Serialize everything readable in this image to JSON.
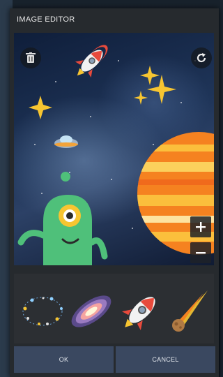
{
  "dialog": {
    "title": "IMAGE EDITOR",
    "ok_label": "OK",
    "cancel_label": "CANCEL"
  },
  "canvas": {
    "icons": [
      "trash-icon",
      "rotate-icon",
      "zoom-in-icon",
      "zoom-out-icon"
    ],
    "stickers_placed": [
      "rocket",
      "sparkle-stars",
      "star",
      "ufo",
      "planet",
      "alien"
    ]
  },
  "palette": {
    "stickers": [
      "galaxy-ring",
      "spiral-galaxy",
      "rocket",
      "comet"
    ]
  },
  "colors": {
    "dialog_bg": "#262a2e",
    "button_bg": "#3a4860",
    "planet_orange": "#f58220",
    "alien_green": "#4fc07a"
  }
}
